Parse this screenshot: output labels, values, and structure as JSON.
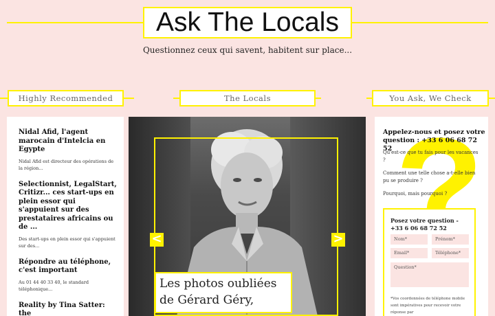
{
  "header": {
    "logo": "Ask The Locals",
    "tagline": "Questionnez ceux qui savent, habitent sur place..."
  },
  "sections": {
    "left_tab": "Highly Recommended",
    "center_tab": "The Locals",
    "right_tab": "You Ask, We Check"
  },
  "posts": [
    {
      "title": "Nidal Afid, l'agent marocain d'Intelcia en Egypte",
      "excerpt": "Nidal Afid est directeur des opérations de la région..."
    },
    {
      "title": "Selectionnist, LegalStart, Critizr... ces start-ups en plein essor qui s'appuient sur des prestataires africains ou de ...",
      "excerpt": "Des start-ups en plein essor qui s'appuient sur des..."
    },
    {
      "title": "Répondre au téléphone, c'est important",
      "excerpt": "Au 01 44 40 33 40, le standard téléphonique..."
    },
    {
      "title": "Reality by Tina Satter: the",
      "excerpt": ""
    }
  ],
  "slider": {
    "caption": "Les photos oubliées de Gérard Géry,",
    "prev_label": "<",
    "next_label": ">"
  },
  "contact": {
    "heading": "Appelez-nous et posez votre question : +33 6 06 68 72 52",
    "faq": [
      "Qu'est-ce que tu fais pour les vacances ?",
      "Comment une telle chose a-t-elle bien pu se produire ?",
      "Pourquoi, mais pourquoi ?"
    ],
    "form": {
      "title": "Posez votre question - +33 6 06 68 72 52",
      "nom": "Nom*",
      "prenom": "Prénom*",
      "email": "Email*",
      "telephone": "Téléphone*",
      "question": "Question*",
      "note": "*Vos coordonnées de téléphone mobile sont impératives pour recevoir votre réponse par"
    }
  },
  "colors": {
    "accent": "#fff200",
    "background": "#fbe4e2"
  }
}
